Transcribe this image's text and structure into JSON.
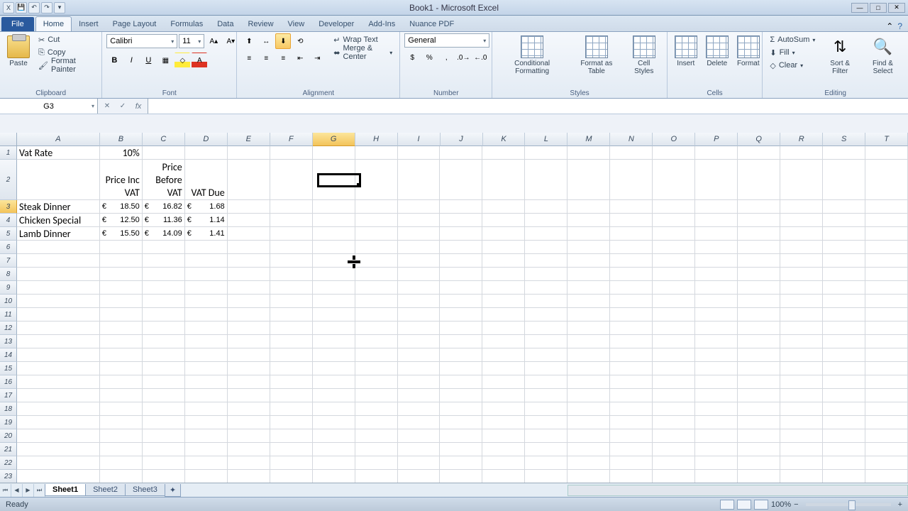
{
  "title": "Book1 - Microsoft Excel",
  "qat": [
    "save",
    "undo",
    "redo"
  ],
  "tabs": {
    "file": "File",
    "list": [
      "Home",
      "Insert",
      "Page Layout",
      "Formulas",
      "Data",
      "Review",
      "View",
      "Developer",
      "Add-Ins",
      "Nuance PDF"
    ],
    "active": "Home"
  },
  "clipboard": {
    "paste": "Paste",
    "cut": "Cut",
    "copy": "Copy",
    "painter": "Format Painter",
    "label": "Clipboard"
  },
  "font": {
    "name": "Calibri",
    "size": "11",
    "label": "Font"
  },
  "alignment": {
    "wrap": "Wrap Text",
    "merge": "Merge & Center",
    "label": "Alignment"
  },
  "number": {
    "format": "General",
    "label": "Number"
  },
  "styles": {
    "cond": "Conditional Formatting",
    "table": "Format as Table",
    "cell": "Cell Styles",
    "label": "Styles"
  },
  "cells": {
    "insert": "Insert",
    "delete": "Delete",
    "format": "Format",
    "label": "Cells"
  },
  "editing": {
    "autosum": "AutoSum",
    "fill": "Fill",
    "clear": "Clear",
    "sort": "Sort & Filter",
    "find": "Find & Select",
    "label": "Editing"
  },
  "namebox": "G3",
  "columns": [
    "A",
    "B",
    "C",
    "D",
    "E",
    "F",
    "G",
    "H",
    "I",
    "J",
    "K",
    "L",
    "M",
    "N",
    "O",
    "P",
    "Q",
    "R",
    "S",
    "T"
  ],
  "selected_col": "G",
  "selected_row": 3,
  "data": {
    "A1": "Vat Rate",
    "B1": "10%",
    "B2": "Price Inc VAT",
    "C2": "Price Before VAT",
    "D2": "VAT Due",
    "A3": "Steak Dinner",
    "B3c": "€",
    "B3v": "18.50",
    "C3c": "€",
    "C3v": "16.82",
    "D3c": "€",
    "D3v": "1.68",
    "A4": "Chicken Special",
    "B4c": "€",
    "B4v": "12.50",
    "C4c": "€",
    "C4v": "11.36",
    "D4c": "€",
    "D4v": "1.14",
    "A5": "Lamb Dinner",
    "B5c": "€",
    "B5v": "15.50",
    "C5c": "€",
    "C5v": "14.09",
    "D5c": "€",
    "D5v": "1.41"
  },
  "sheets": [
    "Sheet1",
    "Sheet2",
    "Sheet3"
  ],
  "active_sheet": "Sheet1",
  "status": "Ready",
  "zoom": "100%"
}
